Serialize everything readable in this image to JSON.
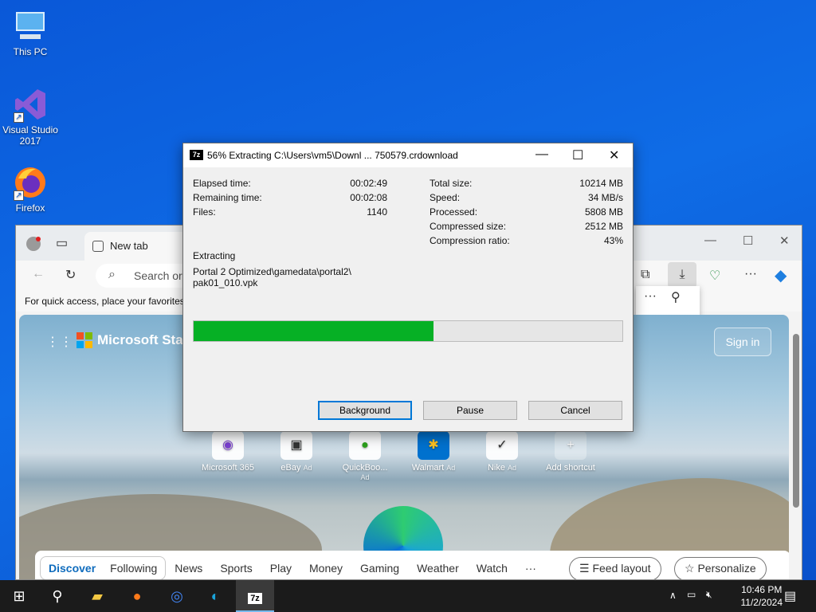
{
  "desktop": {
    "icons": [
      {
        "label": "This PC"
      },
      {
        "label": "Visual Studio 2017"
      },
      {
        "label": "Firefox"
      }
    ]
  },
  "browser": {
    "tab_title": "New tab",
    "address_placeholder": "Search or",
    "favorites_hint": "For quick access, place your favorites",
    "brand": "Microsoft Start",
    "sign_in": "Sign in",
    "shortcuts": [
      {
        "label": "Microsoft 365",
        "ad": ""
      },
      {
        "label": "eBay",
        "ad": "Ad"
      },
      {
        "label": "QuickBoo...",
        "ad": "Ad"
      },
      {
        "label": "Walmart",
        "ad": "Ad"
      },
      {
        "label": "Nike",
        "ad": "Ad"
      },
      {
        "label": "Add shortcut",
        "ad": ""
      }
    ],
    "feed": {
      "discover": "Discover",
      "following": "Following",
      "tabs": [
        "News",
        "Sports",
        "Play",
        "Money",
        "Gaming",
        "Weather",
        "Watch"
      ],
      "more": "···",
      "feed_layout": "Feed layout",
      "personalize": "Personalize"
    }
  },
  "dialog": {
    "title": "56% Extracting C:\\Users\\vm5\\Downl ... 750579.crdownload",
    "logo": "7z",
    "stats_left": [
      {
        "label": "Elapsed time:",
        "value": "00:02:49"
      },
      {
        "label": "Remaining time:",
        "value": "00:02:08"
      },
      {
        "label": "Files:",
        "value": "1140"
      }
    ],
    "stats_right": [
      {
        "label": "Total size:",
        "value": "10214 MB"
      },
      {
        "label": "Speed:",
        "value": "34 MB/s"
      },
      {
        "label": "Processed:",
        "value": "5808 MB"
      },
      {
        "label": "Compressed size:",
        "value": "2512 MB"
      },
      {
        "label": "Compression ratio:",
        "value": "43%"
      }
    ],
    "status_label": "Extracting",
    "current_path_line1": "Portal 2 Optimized\\gamedata\\portal2\\",
    "current_path_line2": "pak01_010.vpk",
    "progress_percent": 56,
    "buttons": {
      "background": "Background",
      "pause": "Pause",
      "cancel": "Cancel"
    }
  },
  "taskbar": {
    "time": "10:46 PM",
    "date": "11/2/2024",
    "active_app_label": "7z"
  }
}
